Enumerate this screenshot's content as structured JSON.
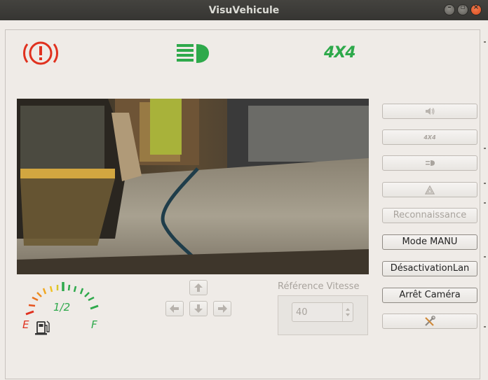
{
  "window": {
    "title": "VisuVehicule"
  },
  "indicators": [
    {
      "name": "brake-warning-icon",
      "color": "#e0311f"
    },
    {
      "name": "headlight-icon",
      "color": "#2ea94b"
    },
    {
      "name": "4x4-icon",
      "label": "4X4",
      "color": "#2ea94b"
    }
  ],
  "side_buttons": {
    "horn": {
      "icon": "speaker-icon"
    },
    "fourwd": {
      "icon": "4x4-small-icon"
    },
    "lights": {
      "icon": "headlight-small-icon"
    },
    "hazard": {
      "icon": "hazard-triangle-icon"
    },
    "recon": {
      "label": "Reconnaissance"
    },
    "mode": {
      "label": "Mode MANU"
    },
    "desact": {
      "label": "DésactivationLan"
    },
    "camera": {
      "label": "Arrêt Caméra"
    },
    "settings": {
      "icon": "tools-icon"
    }
  },
  "fuel_gauge": {
    "empty": "E",
    "half": "1/2",
    "full": "F",
    "level": 0.5
  },
  "speed": {
    "label": "Référence Vitesse",
    "value": "40"
  },
  "colors": {
    "accent_green": "#2ea94b",
    "warning_red": "#e0311f"
  }
}
